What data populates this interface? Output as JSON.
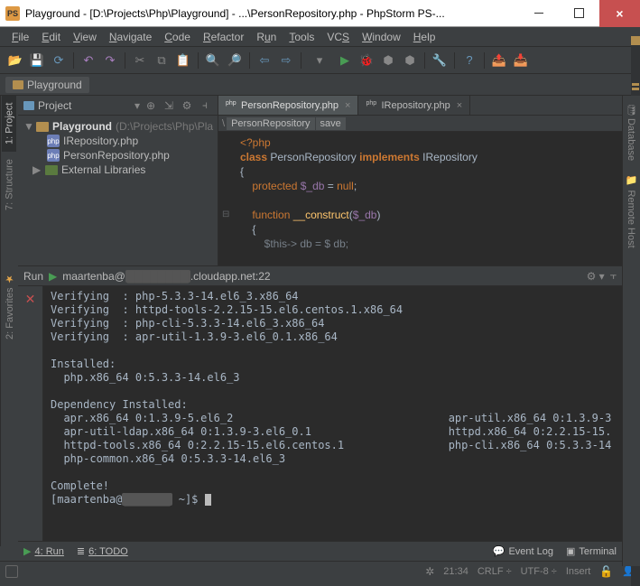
{
  "window": {
    "title": "Playground - [D:\\Projects\\Php\\Playground] - ...\\PersonRepository.php - PhpStorm PS-..."
  },
  "menu": [
    "File",
    "Edit",
    "View",
    "Navigate",
    "Code",
    "Refactor",
    "Run",
    "Tools",
    "VCS",
    "Window",
    "Help"
  ],
  "breadcrumb": {
    "root": "Playground"
  },
  "project_panel": {
    "header": "Project",
    "root_name": "Playground",
    "root_path": "(D:\\Projects\\Php\\Pla",
    "files": [
      "IRepository.php",
      "PersonRepository.php"
    ],
    "external": "External Libraries"
  },
  "editor": {
    "tabs": [
      {
        "label": "PersonRepository.php",
        "active": true
      },
      {
        "label": "IRepository.php",
        "active": false
      }
    ],
    "crumb": [
      "PersonRepository",
      "save"
    ],
    "code": {
      "l1": "<?php",
      "l2_kw": "class",
      "l2_c": "PersonRepository",
      "l2_impl": "implements",
      "l2_i": "IRepository",
      "l3": "{",
      "l4_kw": "protected",
      "l4_v": "$_db",
      "l4_eq": " = ",
      "l4_null": "null",
      "l4_semi": ";",
      "l5_kw": "function",
      "l5_fn": "__construct",
      "l5_paren": "(",
      "l5_v": "$_db",
      "l5_close": ")",
      "l6": "{",
      "l7": "$this-> db = $ db;"
    }
  },
  "run": {
    "header_host": "maartenba@",
    "header_suffix": ".cloudapp.net:22",
    "lines": [
      "Verifying  : php-5.3.3-14.el6_3.x86_64",
      "Verifying  : httpd-tools-2.2.15-15.el6.centos.1.x86_64",
      "Verifying  : php-cli-5.3.3-14.el6_3.x86_64",
      "Verifying  : apr-util-1.3.9-3.el6_0.1.x86_64",
      "",
      "Installed:",
      "  php.x86_64 0:5.3.3-14.el6_3",
      "",
      "Dependency Installed:",
      "  apr.x86_64 0:1.3.9-5.el6_2                                 apr-util.x86_64 0:1.3.9-3",
      "  apr-util-ldap.x86_64 0:1.3.9-3.el6_0.1                     httpd.x86_64 0:2.2.15-15.",
      "  httpd-tools.x86_64 0:2.2.15-15.el6.centos.1                php-cli.x86_64 0:5.3.3-14",
      "  php-common.x86_64 0:5.3.3-14.el6_3",
      "",
      "Complete!"
    ],
    "prompt": "[maartenba@",
    "prompt_suffix": " ~]$ "
  },
  "left_tabs": {
    "t1": "1: Project",
    "t2": "7: Structure",
    "t3": "2: Favorites"
  },
  "right_tabs": {
    "t1": "Database",
    "t2": "Remote Host"
  },
  "bottom": {
    "run": "4: Run",
    "todo": "6: TODO",
    "eventlog": "Event Log",
    "terminal": "Terminal"
  },
  "status": {
    "pos": "21:34",
    "le": "CRLF",
    "enc": "UTF-8",
    "ins": "Insert"
  }
}
